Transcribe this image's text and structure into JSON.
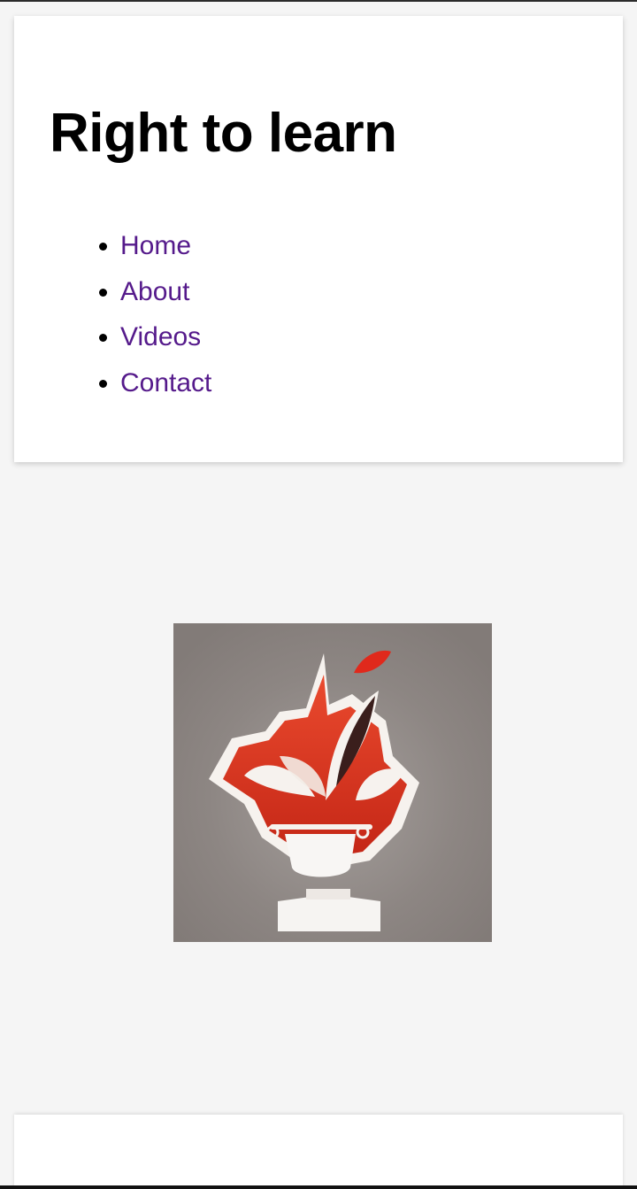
{
  "header": {
    "title": "Right to learn"
  },
  "nav": {
    "items": [
      {
        "label": "Home"
      },
      {
        "label": "About"
      },
      {
        "label": "Videos"
      },
      {
        "label": "Contact"
      }
    ]
  },
  "logo": {
    "icon": "plant-pot-quill-logo",
    "alt": "Right to learn logo"
  },
  "colors": {
    "link": "#551a8b",
    "background": "#f5f5f5",
    "logo_bg": "#8a827f",
    "logo_red": "#d9311f"
  }
}
